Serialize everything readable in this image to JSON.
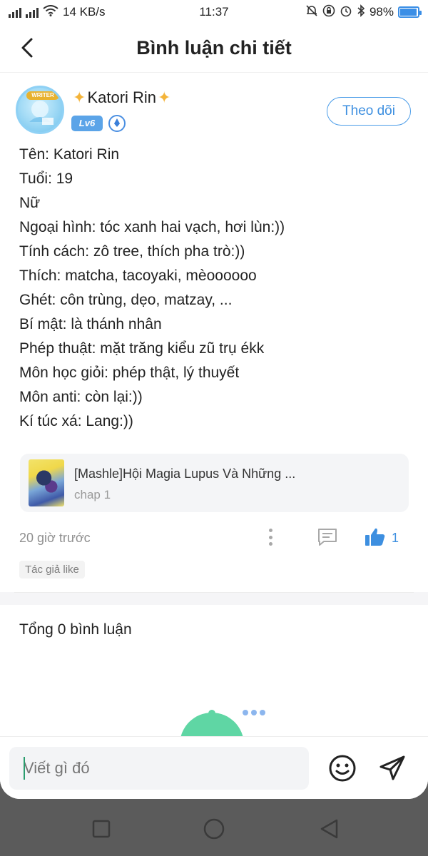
{
  "status_bar": {
    "network_left": "4G",
    "network_right": "3G",
    "speed": "14 KB/s",
    "time": "11:37",
    "battery": "98%",
    "battery_level": 0.98
  },
  "header": {
    "title": "Bình luận chi tiết"
  },
  "post": {
    "author": "Katori Rin",
    "level": "Lv6",
    "avatar_banner": "WRITER",
    "follow_label": "Theo dõi",
    "lines": [
      "Tên: Katori Rin",
      "Tuổi: 19",
      "Nữ",
      "Ngoại hình: tóc xanh hai vạch, hơi lùn:))",
      "Tính cách: zô tree, thích pha trò:))",
      "Thích: matcha, tacoyaki, mèoooooo",
      "Ghét: côn trùng, dẹo, matzay, ...",
      "Bí mật: là thánh nhân",
      "Phép thuật: mặt trăng kiểu zũ trụ ékk",
      "Môn học giỏi: phép thật, lý thuyết",
      "Môn anti: còn lại:))",
      "Kí túc xá: Lang:))"
    ],
    "story": {
      "title": "[Mashle]Hội Magia Lupus Và Những ...",
      "chapter": "chap 1"
    },
    "time_ago": "20 giờ trước",
    "like_count": "1",
    "tag": "Tác giả like"
  },
  "comments": {
    "total_label": "Tổng 0 bình luận"
  },
  "composer": {
    "placeholder": "Viết gì đó"
  },
  "colors": {
    "accent": "#3d8fe0",
    "mascot": "#5fd6a4"
  },
  "icons": [
    "back-arrow-icon",
    "more-vertical-icon",
    "comment-icon",
    "thumbs-up-icon",
    "emoji-icon",
    "send-icon",
    "square-nav-icon",
    "home-circle-nav-icon",
    "back-triangle-nav-icon"
  ]
}
